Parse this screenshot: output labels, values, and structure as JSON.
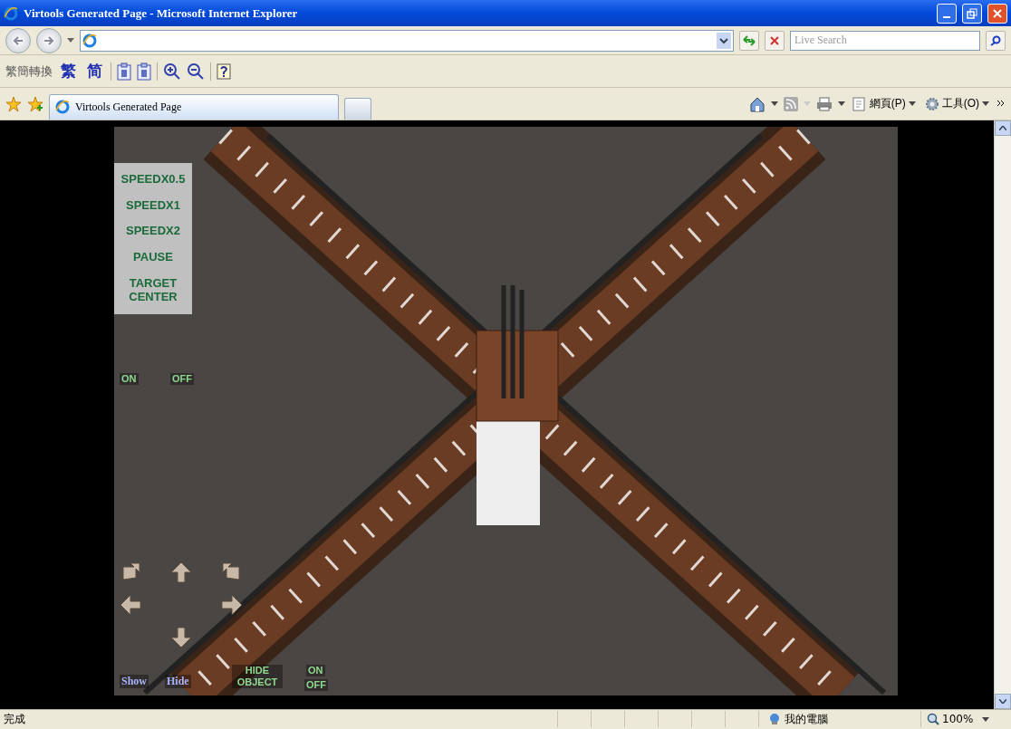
{
  "window": {
    "title": "Virtools Generated Page - Microsoft Internet Explorer"
  },
  "search": {
    "placeholder": "Live Search"
  },
  "conversion_toolbar": {
    "label": "繁簡轉換",
    "buttons": [
      "繁",
      "简"
    ]
  },
  "tabs": [
    {
      "label": "Virtools Generated Page",
      "selected": true
    }
  ],
  "command_bar": {
    "items": [
      "網頁(P)",
      "工具(O)"
    ]
  },
  "scene": {
    "menu": [
      "SPEEDX0.5",
      "SPEEDX1",
      "SPEEDX2",
      "PAUSE",
      "TARGET CENTER"
    ],
    "toggle_top": [
      "ON",
      "OFF"
    ],
    "show_hide": [
      "Show",
      "Hide"
    ],
    "object_label": "HIDE OBJECT",
    "toggle_bottom": [
      "ON",
      "OFF"
    ]
  },
  "status_bar": {
    "text": "完成",
    "zone": "我的電腦",
    "zoom": "100%"
  }
}
